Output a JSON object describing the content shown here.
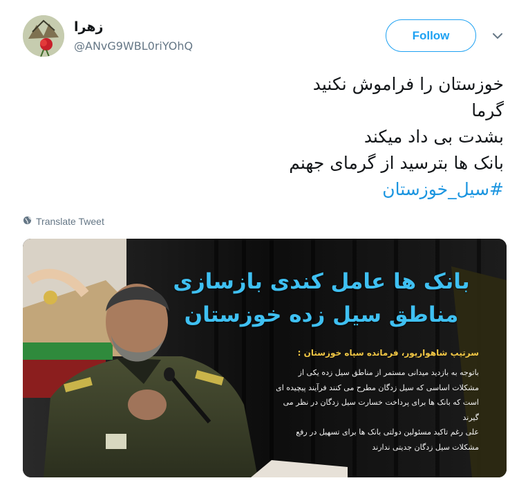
{
  "user": {
    "display_name": "زهرا",
    "handle": "@ANvG9WBL0riYOhQ"
  },
  "header": {
    "follow_label": "Follow",
    "menu_icon": "chevron-down-icon"
  },
  "tweet": {
    "lines": [
      "خوزستان را فراموش نکنید",
      "گرما",
      "بشدت بی داد میکند",
      "بانک ها بترسید از گرمای جهنم"
    ],
    "hashtag": "#سیل_خوزستان"
  },
  "translate": {
    "label": "Translate Tweet",
    "icon": "globe-icon"
  },
  "media": {
    "headline_lines": [
      "بانک ها عامل کندی بازسازی",
      "مناطق سیل زده خوزستان"
    ],
    "caption_title": "سرتیپ شاهوارپور، فرمانده سپاه خوزستان :",
    "caption_lines": [
      "باتوجه به بازدید میدانی مستمر از مناطق سیل زده یکی از",
      "مشکلات اساسی که سیل زدگان مطرح می کنند فرآیند پیچیده ای",
      "است که بانک ها برای پرداخت خسارت سیل زدگان در نظر می",
      "گیرند",
      "علی رغم تاکید مسئولین دولتی بانک ها برای تسهیل در رفع",
      "مشکلات سیل زدگان جدیتی ندارند"
    ]
  },
  "colors": {
    "accent": "#1da1f2",
    "hashtag": "#1b95e0",
    "muted": "#657786",
    "headline": "#3fc0f2",
    "caption_title": "#f2c744"
  }
}
